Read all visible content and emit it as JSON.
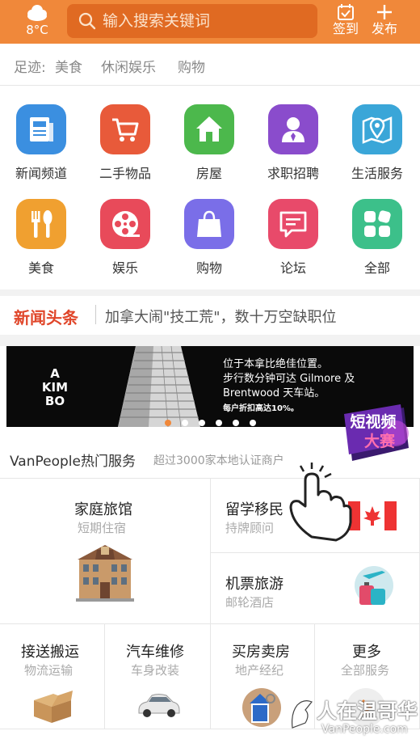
{
  "header": {
    "temperature": "8°C",
    "search_placeholder": "输入搜索关键词",
    "checkin_label": "签到",
    "publish_label": "发布",
    "accent_color": "#f0883a"
  },
  "footprint": {
    "label": "足迹:",
    "items": [
      "美食",
      "休闲娱乐",
      "购物"
    ]
  },
  "categories": [
    {
      "label": "新闻频道",
      "icon": "newspaper-icon",
      "color": "#3b8fe0"
    },
    {
      "label": "二手物品",
      "icon": "shopping-cart-icon",
      "color": "#e85a3a"
    },
    {
      "label": "房屋",
      "icon": "house-icon",
      "color": "#4cb84c"
    },
    {
      "label": "求职招聘",
      "icon": "person-icon",
      "color": "#8a4ccc"
    },
    {
      "label": "生活服务",
      "icon": "map-pin-icon",
      "color": "#3aa6d8"
    },
    {
      "label": "美食",
      "icon": "fork-spoon-icon",
      "color": "#f0a030"
    },
    {
      "label": "娱乐",
      "icon": "film-reel-icon",
      "color": "#e84a5a"
    },
    {
      "label": "购物",
      "icon": "shopping-bag-icon",
      "color": "#7a6ee8"
    },
    {
      "label": "论坛",
      "icon": "chat-icon",
      "color": "#e84a6a"
    },
    {
      "label": "全部",
      "icon": "grid-icon",
      "color": "#3cc08a"
    }
  ],
  "news": {
    "title": "新闻头条",
    "headline": "加拿大闹\"技工荒\"，数十万空缺职位"
  },
  "banner": {
    "logo": "A KIM BO",
    "text_line1": "位于本拿比绝佳位置。",
    "text_line2": "步行数分钟可达 Gilmore 及",
    "text_line3": "Brentwood 天车站。",
    "subtext": "每户折扣高达10%。",
    "dot_count": 6,
    "active_dot": 1
  },
  "promo": {
    "line1": "短视频",
    "line2": "大赛"
  },
  "hot_services": {
    "title": "VanPeople热门服务",
    "subtitle": "超过3000家本地认证商户",
    "cells": [
      {
        "title": "家庭旅馆",
        "subtitle": "短期住宿"
      },
      {
        "title": "留学移民",
        "subtitle": "持牌顾问"
      },
      {
        "title": "机票旅游",
        "subtitle": "邮轮酒店"
      },
      {
        "title": "接送搬运",
        "subtitle": "物流运输"
      },
      {
        "title": "汽车维修",
        "subtitle": "车身改装"
      },
      {
        "title": "买房卖房",
        "subtitle": "地产经纪"
      },
      {
        "title": "更多",
        "subtitle": "全部服务"
      }
    ]
  },
  "watermark": {
    "text": "人在温哥华",
    "sub": "VanPeople.com"
  }
}
